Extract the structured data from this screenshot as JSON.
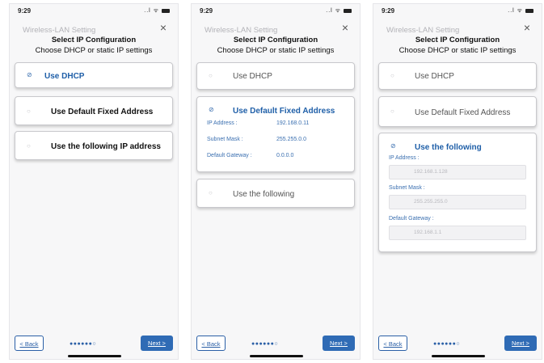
{
  "status": {
    "time": "9:29",
    "icons": "..l ᯤ"
  },
  "nav": {
    "title": "Wireless-LAN Setting",
    "close_icon": "×"
  },
  "header": {
    "title": "Select IP Configuration",
    "subtitle": "Choose DHCP or static IP settings"
  },
  "radio": {
    "selected": "⊘",
    "unselected": "○"
  },
  "screen1": {
    "opt_dhcp": "Use DHCP",
    "opt_fixed": "Use Default Fixed Address",
    "opt_following": "Use the following IP address"
  },
  "screen2": {
    "opt_dhcp": "Use DHCP",
    "opt_fixed": "Use Default Fixed Address",
    "ip_label": "IP Address :",
    "ip_value": "192.168.0.11",
    "mask_label": "Subnet Mask :",
    "mask_value": "255.255.0.0",
    "gw_label": "Default Gateway :",
    "gw_value": "0.0.0.0",
    "opt_following": "Use the following"
  },
  "screen3": {
    "opt_dhcp": "Use DHCP",
    "opt_fixed": "Use Default Fixed Address",
    "opt_following": "Use the following",
    "ip_label": "IP Address :",
    "ip_placeholder": "192.168.1.128",
    "mask_label": "Subnet Mask :",
    "mask_placeholder": "255.255.255.0",
    "gw_label": "Default Gateway :",
    "gw_placeholder": "192.168.1.1"
  },
  "footer": {
    "back": "< Back",
    "next": "Next >",
    "dots": "●●●●●●○"
  }
}
